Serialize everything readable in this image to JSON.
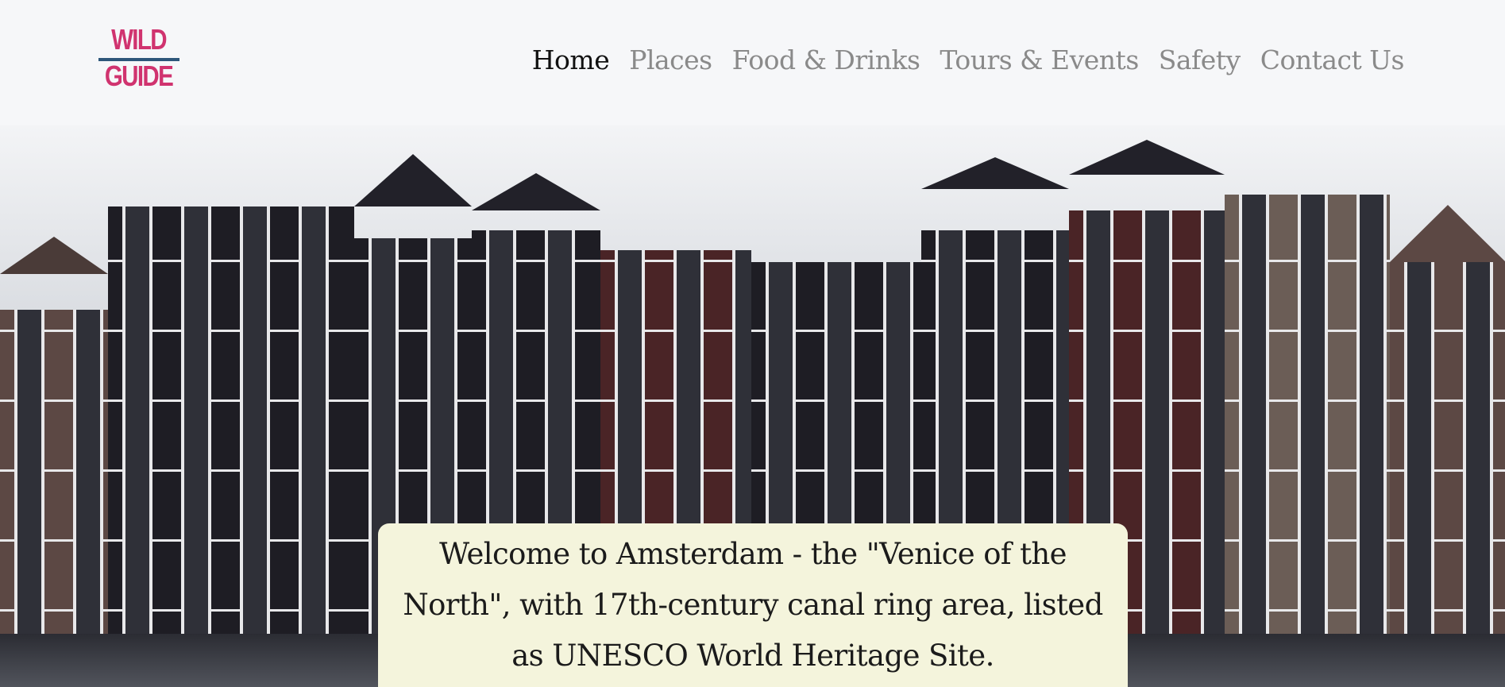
{
  "logo": {
    "line1": "WILD",
    "line2": "GUIDE"
  },
  "nav": {
    "items": [
      {
        "label": "Home"
      },
      {
        "label": "Places"
      },
      {
        "label": "Food & Drinks"
      },
      {
        "label": "Tours & Events"
      },
      {
        "label": "Safety"
      },
      {
        "label": "Contact Us"
      }
    ]
  },
  "hero": {
    "welcome_text": "Welcome to Amsterdam - the \"Venice of the North\", with 17th-century canal ring area, listed as UNESCO World Heritage Site."
  },
  "colors": {
    "header_bg": "#f6f7f9",
    "logo_pink": "#d0336f",
    "logo_blue": "#2d567a",
    "nav_active": "#111111",
    "nav_inactive": "#8a8a8a",
    "caption_bg": "#f4f4dc"
  }
}
